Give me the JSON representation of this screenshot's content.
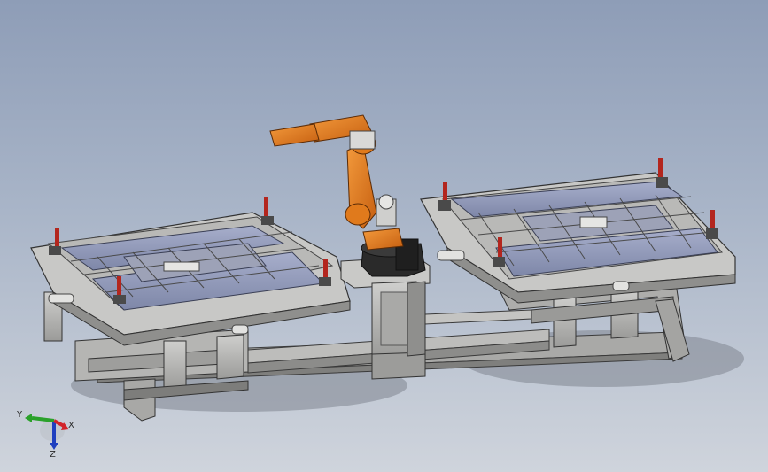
{
  "viewport": {
    "background_top": "#8e9db7",
    "background_bottom": "#cfd4dc"
  },
  "model": {
    "robot_color": "#e07a1c",
    "frame_color": "#b7b7b5",
    "tooling_color": "#8a93b4",
    "clamp_handle_color": "#b3261e"
  },
  "triad": {
    "x_label": "X",
    "y_label": "Y",
    "z_label": "Z",
    "x_color": "#d2232a",
    "y_color": "#2aa12a",
    "z_color": "#1f3fbf"
  }
}
